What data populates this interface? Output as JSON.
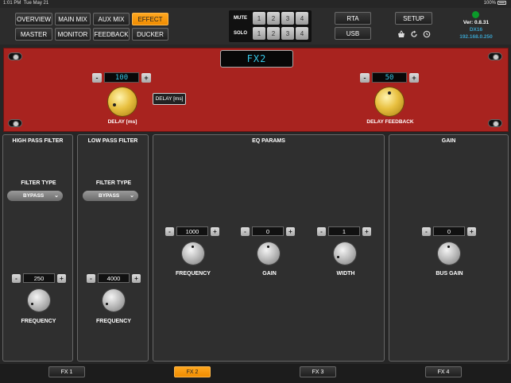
{
  "status_bar": {
    "time": "1:01 PM",
    "date": "Tue May 21",
    "battery": "100%"
  },
  "nav": {
    "row1": [
      "OVERVIEW",
      "MAIN MIX",
      "AUX MIX",
      "EFFECT"
    ],
    "row2": [
      "MASTER",
      "MONITOR",
      "FEEDBACK",
      "DUCKER"
    ],
    "active": "EFFECT"
  },
  "mute_solo": {
    "mute_label": "MUTE",
    "solo_label": "SOLO",
    "mute_buttons": [
      "1",
      "2",
      "3",
      "4"
    ],
    "solo_buttons": [
      "1",
      "2",
      "3",
      "4"
    ]
  },
  "right_buttons": {
    "rta": "RTA",
    "usb": "USB",
    "setup": "SETUP"
  },
  "device": {
    "version": "Ver: 0.8.31",
    "model": "DX16",
    "ip": "192.168.0.250",
    "status_color": "#0b9a2a"
  },
  "fx_panel": {
    "title": "FX2",
    "delay": {
      "value": "100",
      "label": "DELAY [ms]",
      "level": 0.35
    },
    "unit_button": "DELAY [ms]",
    "feedback": {
      "value": "50",
      "label": "DELAY FEEDBACK",
      "level": 0.5
    },
    "color": "#a8231f"
  },
  "sections": {
    "high_pass": {
      "title": "HIGH PASS FILTER",
      "filter_type_label": "FILTER TYPE",
      "filter_type": "BYPASS",
      "value": "250",
      "knob_label": "FREQUENCY"
    },
    "low_pass": {
      "title": "LOW PASS FILTER",
      "filter_type_label": "FILTER TYPE",
      "filter_type": "BYPASS",
      "value": "4000",
      "knob_label": "FREQUENCY"
    },
    "eq": {
      "title": "EQ PARAMS",
      "frequency": {
        "value": "1000",
        "label": "FREQUENCY"
      },
      "gain": {
        "value": "0",
        "label": "GAIN"
      },
      "width": {
        "value": "1",
        "label": "WIDTH"
      }
    },
    "gain": {
      "title": "GAIN",
      "value": "0",
      "label": "BUS GAIN"
    }
  },
  "tabs": {
    "items": [
      "FX 1",
      "FX 2",
      "FX 3",
      "FX 4"
    ],
    "active": "FX 2"
  },
  "icons": {
    "shop": "basket-icon",
    "reset": "refresh-icon",
    "history": "history-icon"
  }
}
